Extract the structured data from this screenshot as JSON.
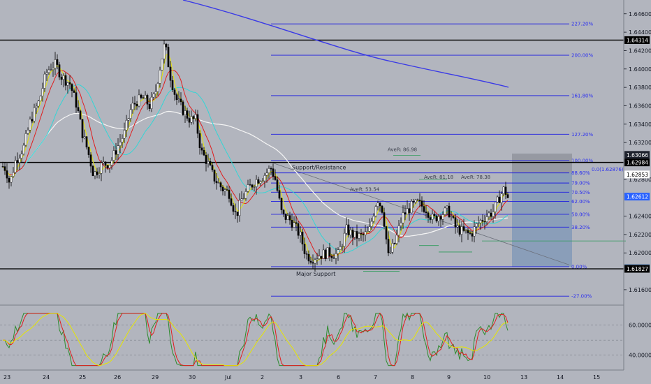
{
  "colors": {
    "background": "#b2b5be",
    "bull_candle": "#ffffff",
    "bear_candle": "#000000",
    "ma_fast": "#e6e600",
    "ma_mid": "#e01e1e",
    "ma_slow": "#32d6d6",
    "ma_long": "#f5f5f5",
    "ma_very_long": "#3a3ae6",
    "fib": "#1f1fe0",
    "hline": "#000000",
    "rsi_green": "#2e8b2e",
    "rsi_red": "#e01e1e",
    "rsi_yellow": "#e6e600",
    "projection_box": "#6f8fb5",
    "projection_box_upper": "#8a8d96"
  },
  "chart_data": {
    "type": "candlestick",
    "price_axis": {
      "ylim": [
        1.6144,
        1.6475
      ],
      "ticks": [
        {
          "label": "1.64600",
          "value": 1.646
        },
        {
          "label": "1.64400",
          "value": 1.644
        },
        {
          "label": "1.64200",
          "value": 1.642
        },
        {
          "label": "1.64000",
          "value": 1.64
        },
        {
          "label": "1.63800",
          "value": 1.638
        },
        {
          "label": "1.63600",
          "value": 1.636
        },
        {
          "label": "1.63400",
          "value": 1.634
        },
        {
          "label": "1.63200",
          "value": 1.632
        },
        {
          "label": "1.62800",
          "value": 1.628
        },
        {
          "label": "1.62400",
          "value": 1.624
        },
        {
          "label": "1.62200",
          "value": 1.622
        },
        {
          "label": "1.62000",
          "value": 1.62
        },
        {
          "label": "1.61600",
          "value": 1.616
        }
      ],
      "price_tags": [
        {
          "label": "1.64314",
          "value": 1.64314,
          "bg": "#000000",
          "fg": "#ffffff"
        },
        {
          "label": "1.63066",
          "value": 1.63066,
          "bg": "#1e222d",
          "fg": "#ffffff"
        },
        {
          "label": "1.62984",
          "value": 1.62984,
          "bg": "#000000",
          "fg": "#ffffff"
        },
        {
          "label": "1.62853",
          "value": 1.62853,
          "bg": "#ffffff",
          "fg": "#000000"
        },
        {
          "label": "1.62612",
          "value": 1.62612,
          "bg": "#2962ff",
          "fg": "#ffffff"
        },
        {
          "label": "1.61837",
          "value": 1.61837,
          "bg": "#6f8fb5",
          "fg": "#ffffff"
        },
        {
          "label": "1.61827",
          "value": 1.61827,
          "bg": "#000000",
          "fg": "#ffffff"
        }
      ]
    },
    "time_axis": {
      "labels": [
        "23",
        "24",
        "25",
        "26",
        "29",
        "30",
        "Jul",
        "2",
        "3",
        "6",
        "7",
        "8",
        "9",
        "10",
        "13",
        "14",
        "15"
      ]
    },
    "horizontal_levels": [
      {
        "price": 1.64314,
        "label": ""
      },
      {
        "price": 1.62984,
        "label": "Support/Resistance"
      },
      {
        "price": 1.61827,
        "label": "Major Support"
      }
    ],
    "fibonacci": [
      {
        "ratio": "227.20%",
        "price": 1.6449
      },
      {
        "ratio": "200.00%",
        "price": 1.6415
      },
      {
        "ratio": "161.80%",
        "price": 1.6371
      },
      {
        "ratio": "127.20%",
        "price": 1.6329
      },
      {
        "ratio": "100.00%",
        "price": 1.63005
      },
      {
        "ratio": "88.60%",
        "price": 1.6287
      },
      {
        "ratio": "79.00%",
        "price": 1.6276
      },
      {
        "ratio": "70.50%",
        "price": 1.6266
      },
      {
        "ratio": "62.00%",
        "price": 1.6256
      },
      {
        "ratio": "50.00%",
        "price": 1.6242
      },
      {
        "ratio": "38.20%",
        "price": 1.6228
      },
      {
        "ratio": "0.00%",
        "price": 1.6185
      },
      {
        "ratio": "-27.00%",
        "price": 1.6153
      }
    ],
    "annotations": {
      "support_resistance": "Support/Resistance",
      "major_support": "Major Support",
      "ave_labels": [
        {
          "text": "AveR: 86.98"
        },
        {
          "text": "AveR: 81.18"
        },
        {
          "text": "AveR: 78.38"
        },
        {
          "text": "AveR: 53.54"
        }
      ],
      "fib_extra": "0.0(1.62876)"
    },
    "rsi": {
      "ticks": [
        {
          "label": "60.0000",
          "value": 60
        },
        {
          "label": "40.0000",
          "value": 40
        }
      ],
      "ylim": [
        30,
        72
      ]
    },
    "projection": {
      "top": 1.6308,
      "mid": 1.6287,
      "bottom": 1.6185
    }
  }
}
